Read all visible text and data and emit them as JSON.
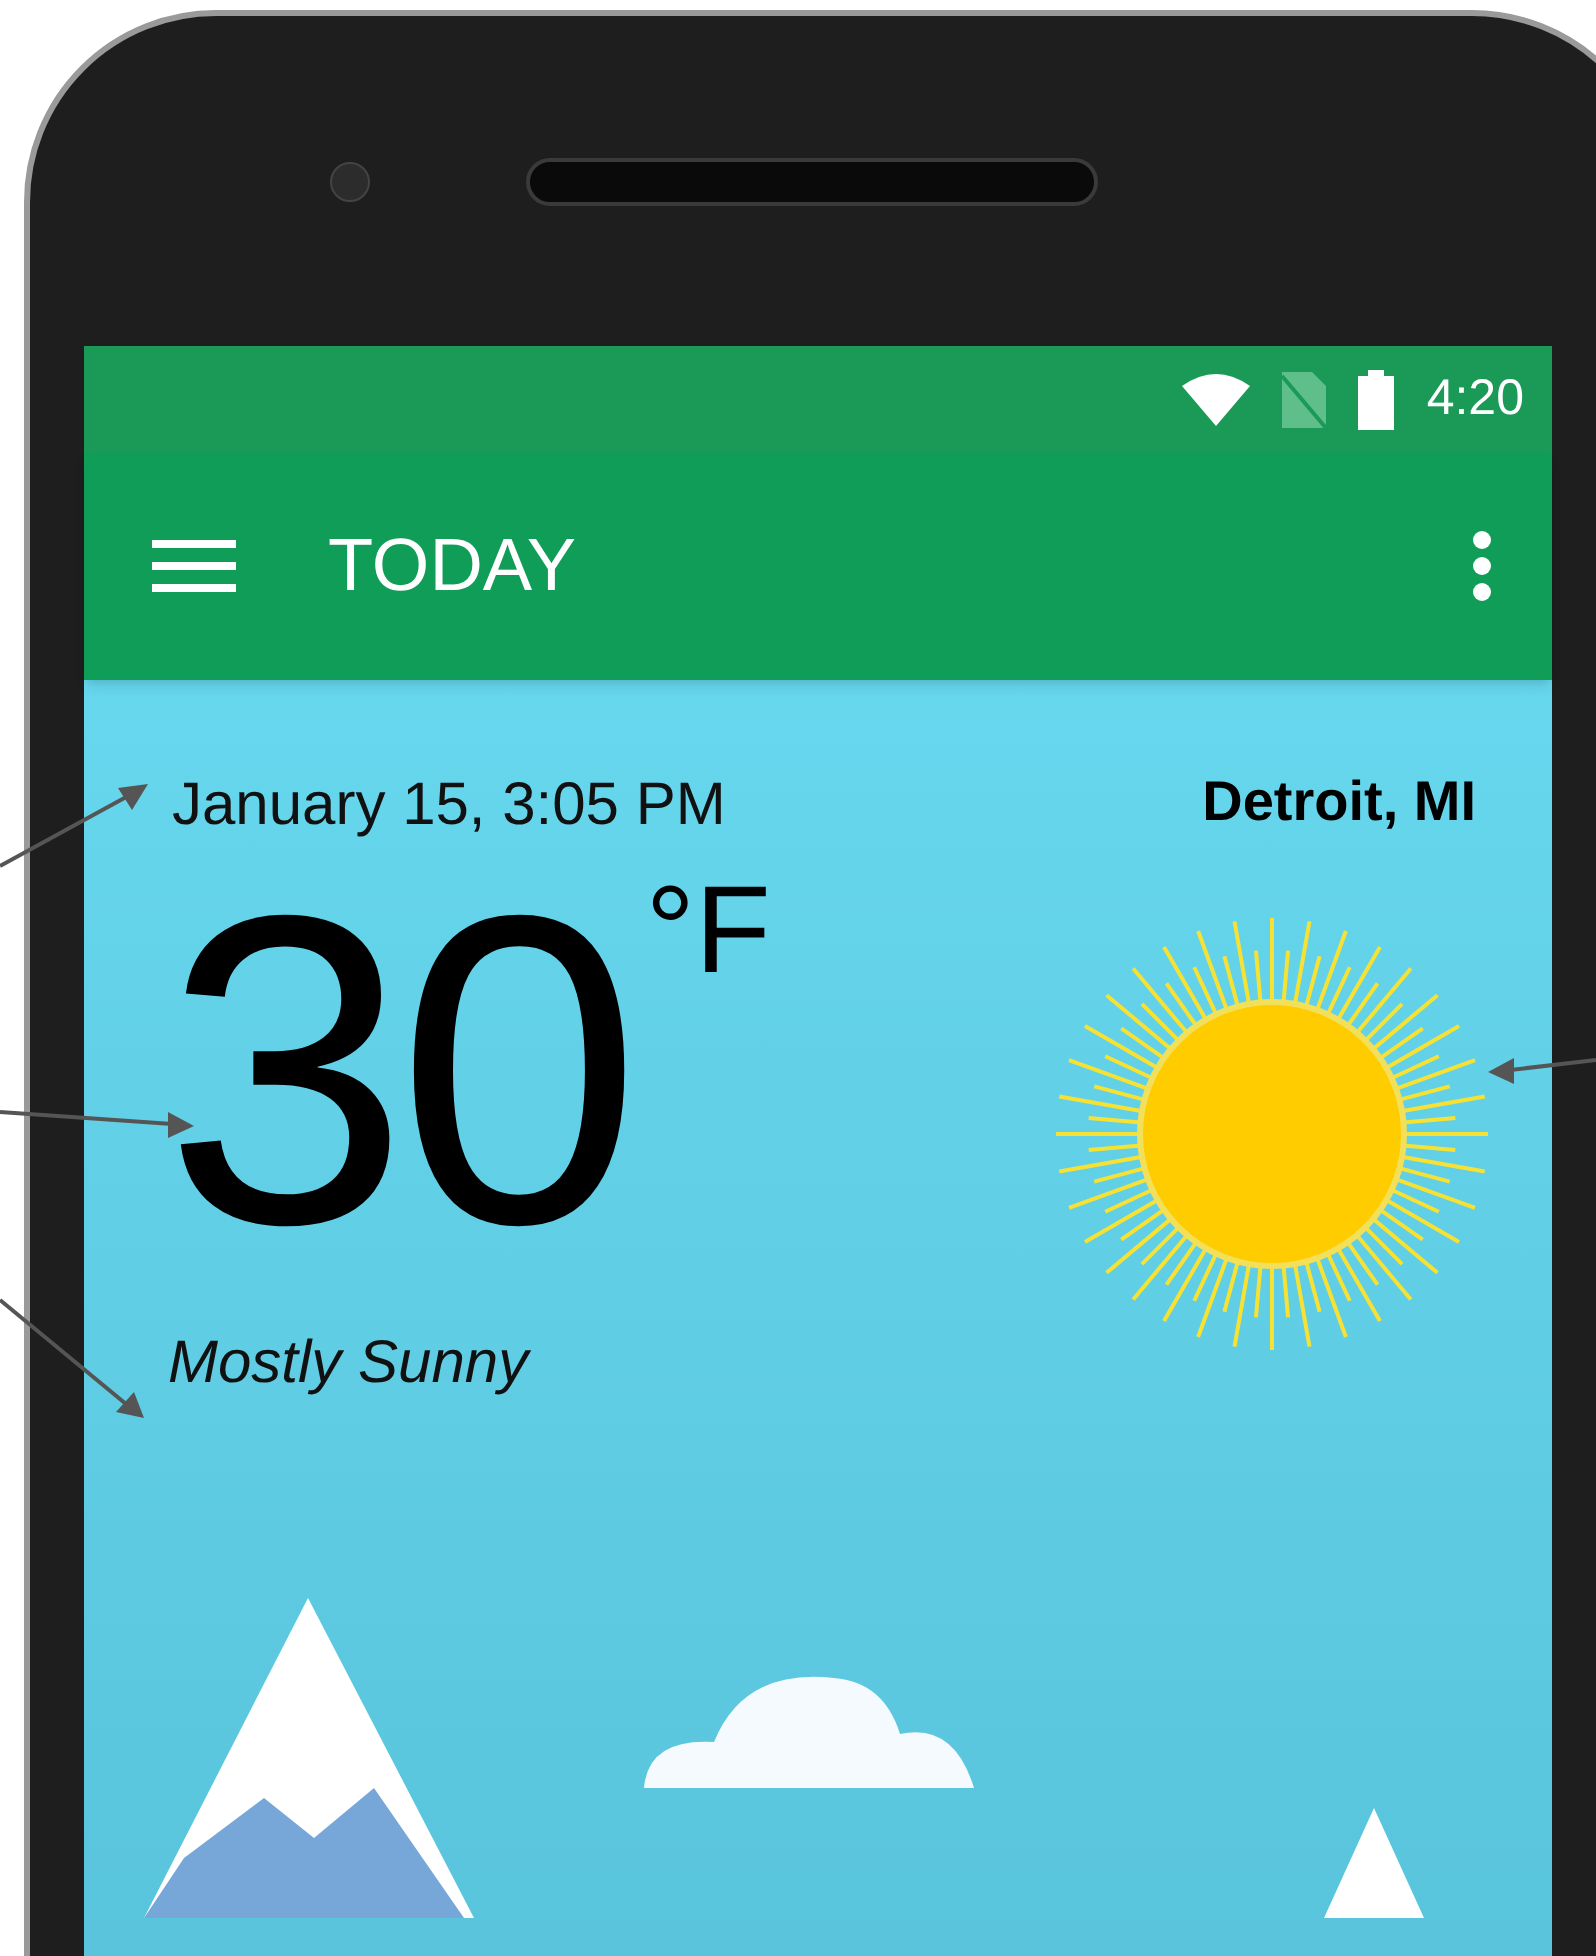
{
  "status_bar": {
    "time": "4:20"
  },
  "app_bar": {
    "title": "TODAY"
  },
  "weather": {
    "datetime": "January 15, 3:05 PM",
    "location": "Detroit, MI",
    "temperature": "30",
    "unit": "°F",
    "condition": "Mostly Sunny"
  }
}
